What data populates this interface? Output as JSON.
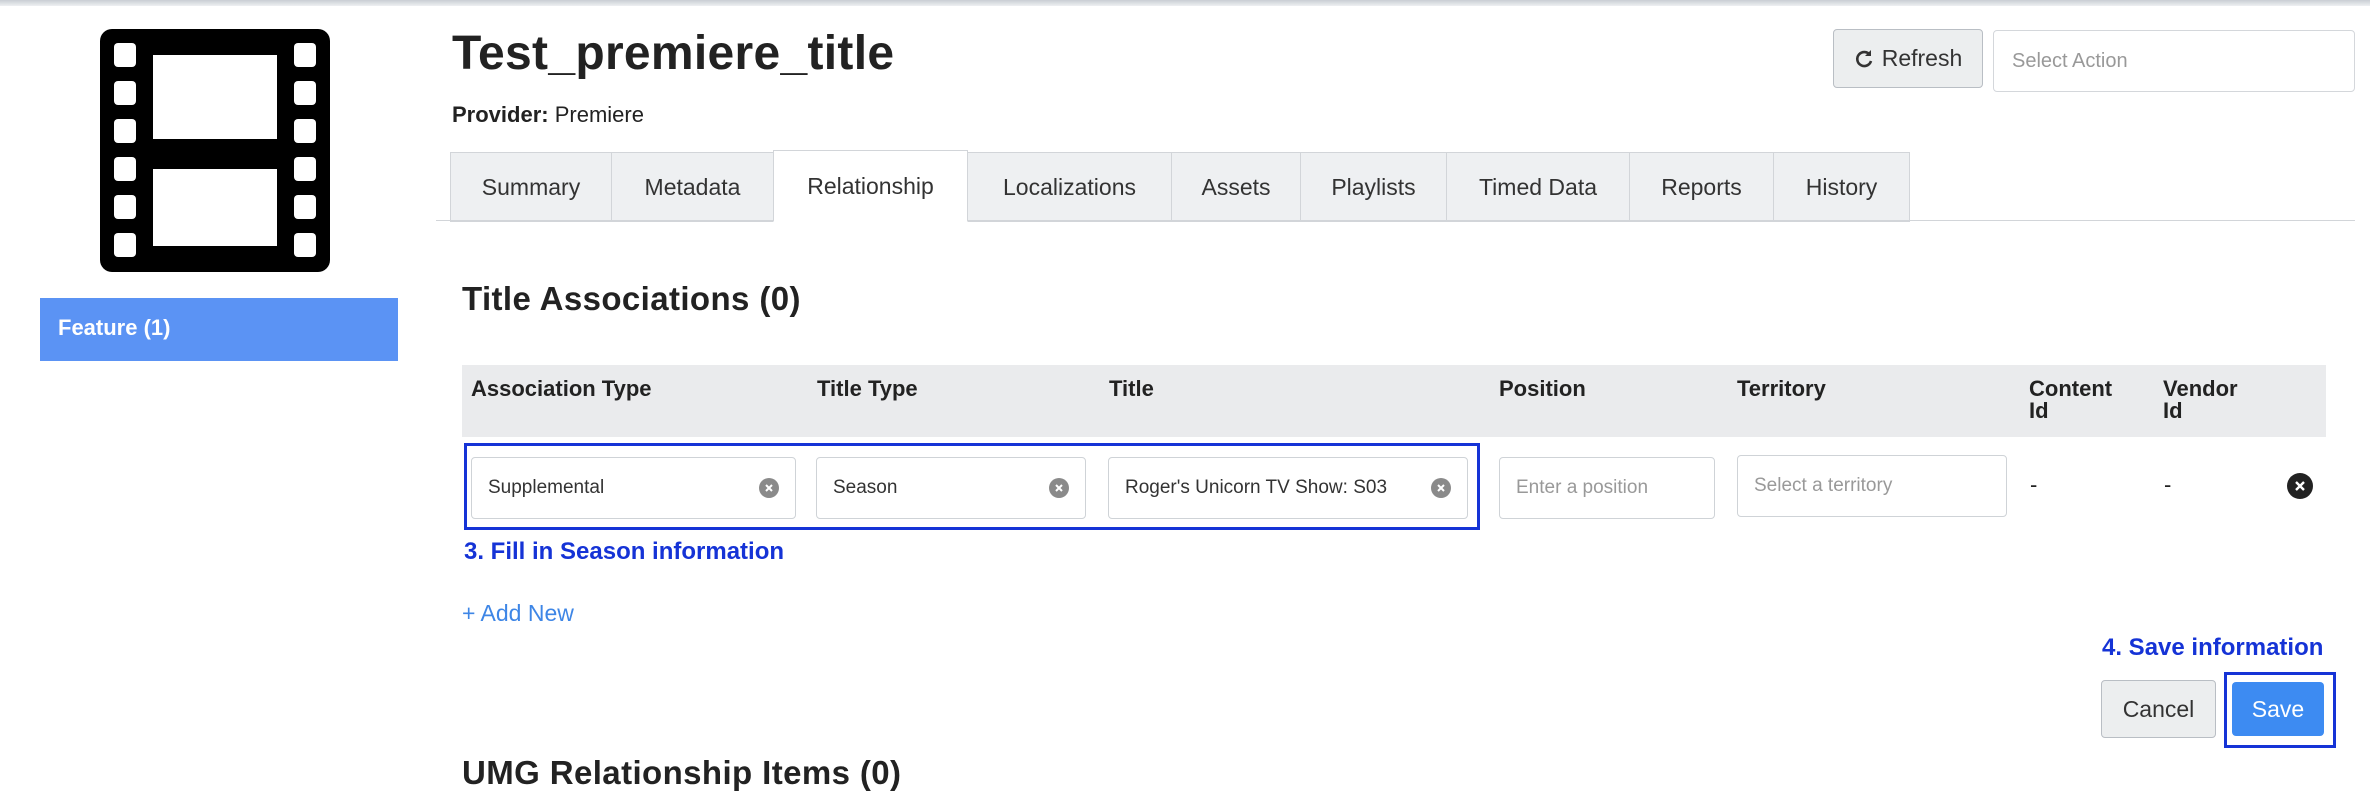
{
  "sidebar": {
    "logo_icon": "film-strip-icon",
    "feature_label": "Feature (1)"
  },
  "header": {
    "title": "Test_premiere_title",
    "provider_label": "Provider:",
    "provider_value": "Premiere",
    "refresh_label": "Refresh",
    "refresh_icon": "refresh-icon",
    "action_placeholder": "Select Action"
  },
  "tabs": [
    {
      "label": "Summary",
      "active": false
    },
    {
      "label": "Metadata",
      "active": false
    },
    {
      "label": "Relationship",
      "active": true
    },
    {
      "label": "Localizations",
      "active": false
    },
    {
      "label": "Assets",
      "active": false
    },
    {
      "label": "Playlists",
      "active": false
    },
    {
      "label": "Timed Data",
      "active": false
    },
    {
      "label": "Reports",
      "active": false
    },
    {
      "label": "History",
      "active": false
    }
  ],
  "associations": {
    "title": "Title Associations (0)",
    "columns": [
      "Association Type",
      "Title Type",
      "Title",
      "Position",
      "Territory",
      "Content Id",
      "Vendor Id"
    ],
    "row": {
      "association_type": "Supplemental",
      "title_type": "Season",
      "title": "Roger's Unicorn TV Show: S03",
      "position_placeholder": "Enter a position",
      "territory_placeholder": "Select a territory",
      "content_id": "-",
      "vendor_id": "-"
    },
    "add_new": "+ Add New"
  },
  "annotations": {
    "step3": "3. Fill in Season information",
    "step4": "4. Save information",
    "color": "#1533d6"
  },
  "actions": {
    "cancel": "Cancel",
    "save": "Save"
  },
  "next_section": {
    "title": "UMG Relationship Items (0)"
  },
  "colors": {
    "feature_bg": "#5b93f4",
    "save_bg": "#3d8bf2",
    "link": "#3e86e6"
  }
}
